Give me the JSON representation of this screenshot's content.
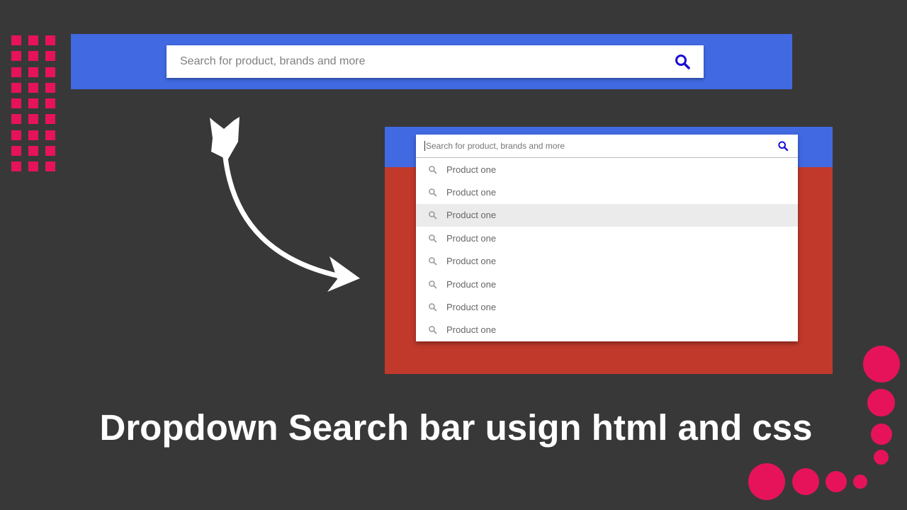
{
  "colors": {
    "background": "#383838",
    "accent": "#e6135b",
    "banner_blue": "#4169e1",
    "panel_red": "#c0392b",
    "search_icon_blue": "#1a0dd4"
  },
  "top_search": {
    "placeholder": "Search for product, brands and more",
    "icon": "search-icon"
  },
  "demo": {
    "input_placeholder": "Search for product, brands and more",
    "icon": "search-icon",
    "suggestions": [
      {
        "label": "Product one",
        "icon": "search-icon"
      },
      {
        "label": "Product one",
        "icon": "search-icon"
      },
      {
        "label": "Product one",
        "icon": "search-icon",
        "highlighted": true
      },
      {
        "label": "Product one",
        "icon": "search-icon"
      },
      {
        "label": "Product one",
        "icon": "search-icon"
      },
      {
        "label": "Product one",
        "icon": "search-icon"
      },
      {
        "label": "Product one",
        "icon": "search-icon"
      },
      {
        "label": "Product one",
        "icon": "search-icon"
      }
    ]
  },
  "title": "Dropdown Search bar usign html and css"
}
